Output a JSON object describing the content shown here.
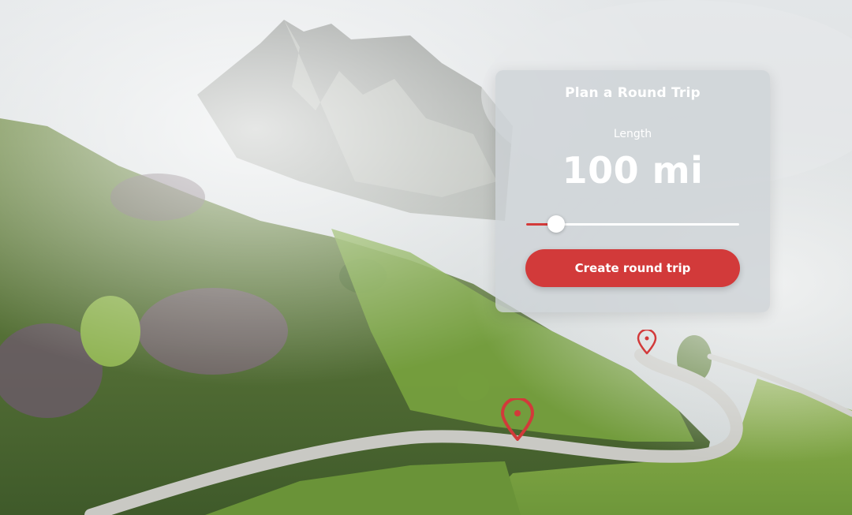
{
  "panel": {
    "title": "Plan a Round Trip",
    "length_label": "Length",
    "length_value": "100 mi",
    "create_button_label": "Create round trip"
  },
  "slider": {
    "fraction": 0.14
  },
  "colors": {
    "accent": "#d23a3a",
    "text": "#ffffff"
  },
  "icons": {
    "marker_large": "map-pin-icon",
    "marker_small": "map-pin-icon"
  }
}
